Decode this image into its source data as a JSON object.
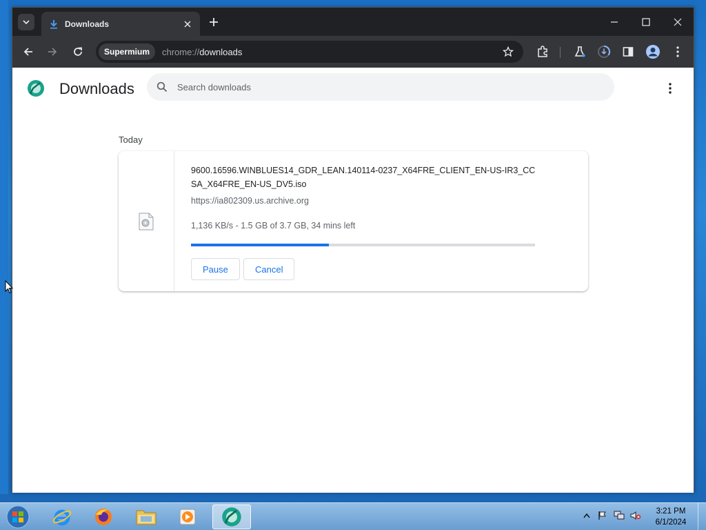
{
  "browser": {
    "tab_title": "Downloads",
    "profile_chip": "Supermium",
    "url_scheme": "chrome://",
    "url_host": "downloads"
  },
  "page": {
    "title": "Downloads",
    "search_placeholder": "Search downloads",
    "section_label": "Today"
  },
  "download": {
    "filename": "9600.16596.WINBLUES14_GDR_LEAN.140114-0237_X64FRE_CLIENT_EN-US-IR3_CCSA_X64FRE_EN-US_DV5.iso",
    "source_url": "https://ia802309.us.archive.org",
    "status": "1,136 KB/s - 1.5 GB of 3.7 GB, 34 mins left",
    "progress_fraction": 0.4,
    "pause_label": "Pause",
    "cancel_label": "Cancel"
  },
  "taskbar": {
    "time": "3:21 PM",
    "date": "6/1/2024",
    "apps": [
      "internet-explorer-icon",
      "firefox-icon",
      "file-explorer-icon",
      "media-player-icon",
      "supermium-icon"
    ]
  },
  "colors": {
    "accent": "#1a73e8",
    "tabstrip": "#202124",
    "toolbar": "#35363a"
  }
}
